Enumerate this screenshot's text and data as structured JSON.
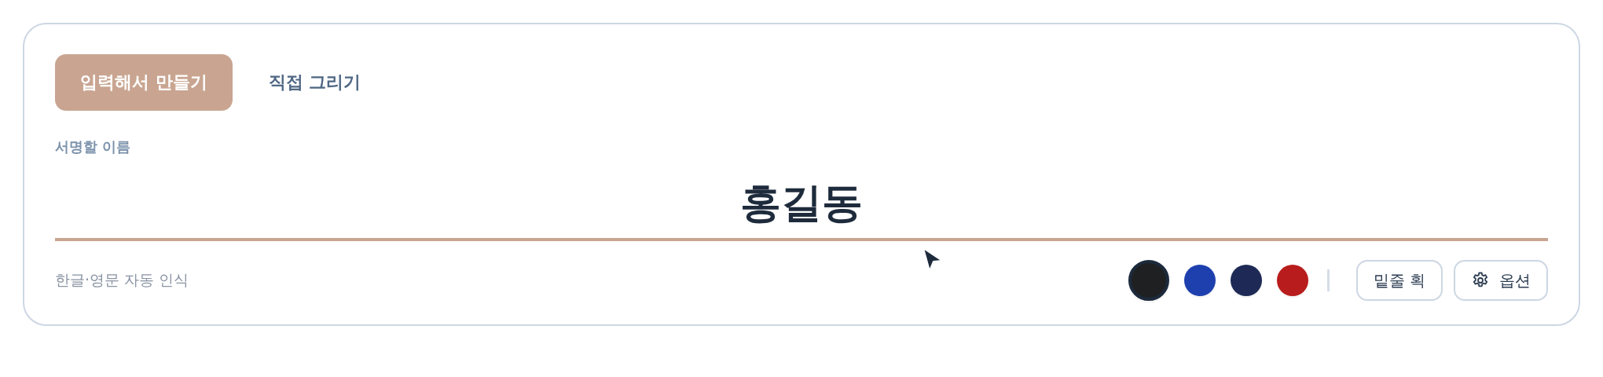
{
  "tabs": [
    {
      "label": "입력해서 만들기",
      "selected": true
    },
    {
      "label": "직접 그리기",
      "selected": false
    }
  ],
  "name_field": {
    "label": "서명할 이름",
    "value": "홍길동"
  },
  "hint": "한글·영문 자동 인식",
  "colors": [
    {
      "color": "#1f2022",
      "selected": true
    },
    {
      "color": "#1e40af",
      "selected": false
    },
    {
      "color": "#1e2a55",
      "selected": false
    },
    {
      "color": "#b91c1c",
      "selected": false
    }
  ],
  "buttons": [
    {
      "kind": "plain",
      "label": "밑줄 획"
    },
    {
      "kind": "settings",
      "label": "옵션"
    }
  ]
}
